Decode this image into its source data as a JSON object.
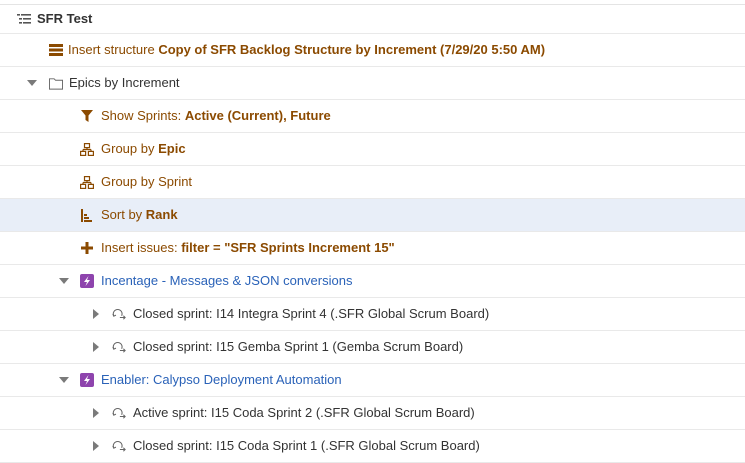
{
  "colors": {
    "generator": "#8b4a00",
    "issue_link": "#2a62b8",
    "epic_icon_bg": "#8e44ad",
    "row_selected_bg": "#e8eef8",
    "folder_stroke": "#666666",
    "arrow": "#7a7a7a"
  },
  "root": {
    "icon": "structure-icon",
    "label": "SFR Test"
  },
  "rows": [
    {
      "icon": "insert-structure-icon",
      "label": "Insert structure ",
      "value": "Copy of SFR Backlog Structure by Increment (7/29/20 5:50 AM)"
    },
    {
      "icon": "folder-icon",
      "label": "Epics by Increment",
      "expanded": true
    },
    {
      "icon": "filter-icon",
      "label": "Show Sprints: ",
      "value": "Active (Current), Future"
    },
    {
      "icon": "group-icon",
      "label": "Group by ",
      "value": "Epic"
    },
    {
      "icon": "group-icon",
      "label": "Group by Sprint"
    },
    {
      "icon": "sort-icon",
      "label": "Sort by ",
      "value": "Rank",
      "selected": true
    },
    {
      "icon": "plus-icon",
      "label": "Insert issues: ",
      "value": "filter = \"SFR Sprints Increment 15\""
    },
    {
      "icon": "epic-icon",
      "label": "Incentage - Messages & JSON conversions",
      "expanded": true
    },
    {
      "icon": "sprint-icon",
      "label": "Closed sprint: I14 Integra Sprint 4 (.SFR Global Scrum Board)",
      "expanded": false
    },
    {
      "icon": "sprint-icon",
      "label": "Closed sprint: I15 Gemba Sprint 1 (Gemba Scrum Board)",
      "expanded": false
    },
    {
      "icon": "epic-icon",
      "label": "Enabler: Calypso Deployment Automation",
      "expanded": true
    },
    {
      "icon": "sprint-icon",
      "label": "Active sprint: I15 Coda Sprint 2 (.SFR Global Scrum Board)",
      "expanded": false
    },
    {
      "icon": "sprint-icon",
      "label": "Closed sprint: I15 Coda Sprint 1 (.SFR Global Scrum Board)",
      "expanded": false
    }
  ]
}
